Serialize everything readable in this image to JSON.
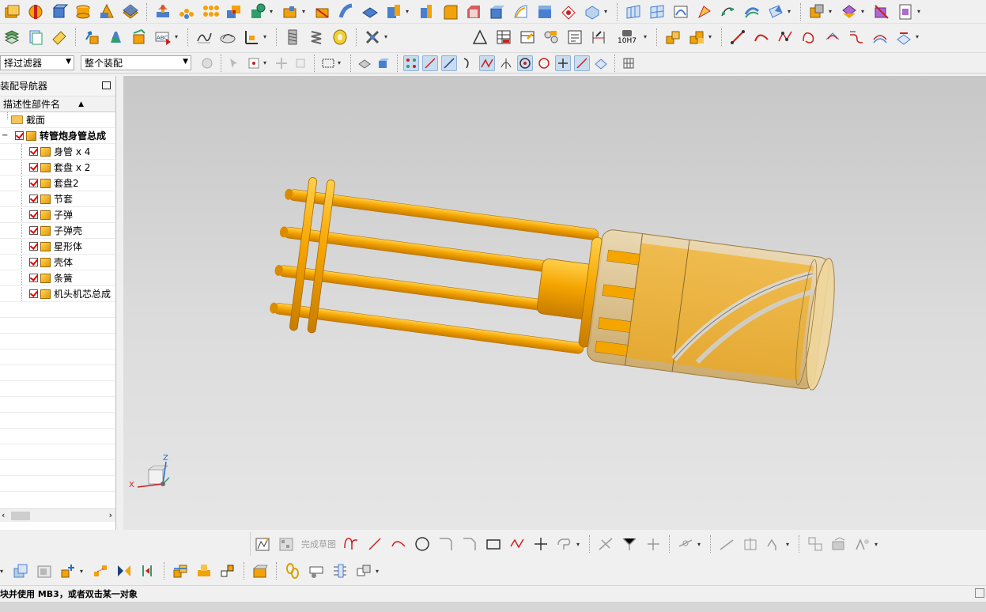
{
  "filters": {
    "selection_filter": "择过滤器",
    "scope": "整个装配"
  },
  "toolbar2": {
    "tolerance_label": "10H7"
  },
  "navigator": {
    "title": "装配导航器",
    "column_header": "描述性部件名",
    "section_folder": "截面",
    "root_assembly": "转管炮身管总成",
    "children": [
      "身管 x 4",
      "套盘 x 2",
      "套盘2",
      "节套",
      "子弹",
      "子弹壳",
      "星形体",
      "壳体",
      "条簧",
      "机头机芯总成"
    ]
  },
  "sketch_toolbar": {
    "finish_sketch": "完成草图"
  },
  "status_bar": {
    "message": "块并使用 MB3，或者双击某一对象"
  },
  "triad": {
    "x": "X",
    "z": "Z"
  },
  "colors": {
    "part_orange": "#f5a500",
    "part_dark": "#c77c00",
    "housing_transparent": "#e8c98a",
    "check_red": "#d00000"
  }
}
